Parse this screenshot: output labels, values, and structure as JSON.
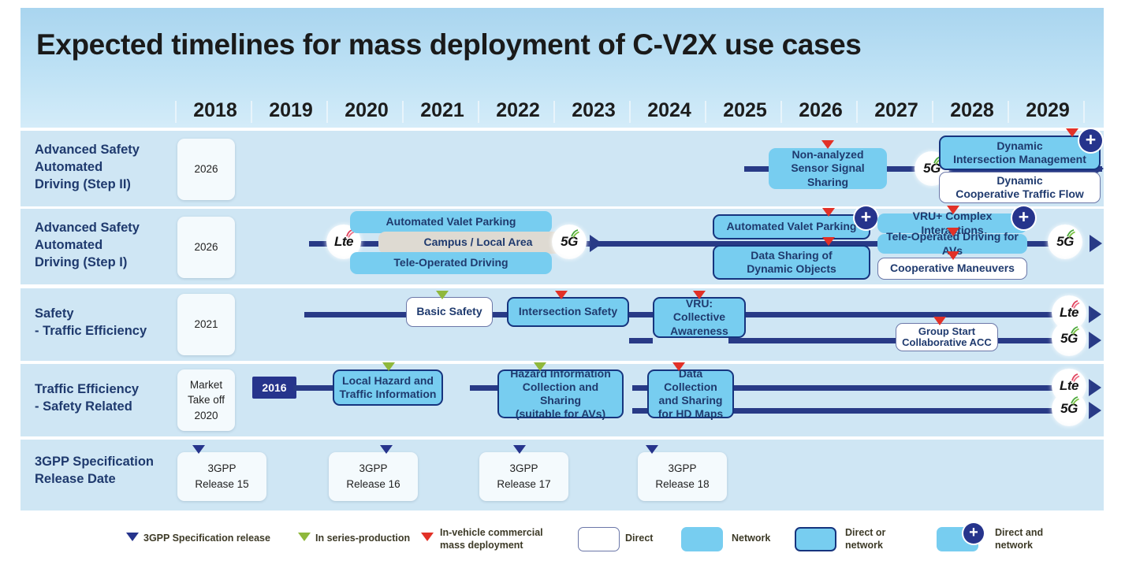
{
  "header": {
    "title": "Expected timelines for mass deployment of C-V2X use cases"
  },
  "timeline": {
    "years": [
      "2018",
      "2019",
      "2020",
      "2021",
      "2022",
      "2023",
      "2024",
      "2025",
      "2026",
      "2027",
      "2028",
      "2029"
    ]
  },
  "rows": [
    {
      "label": "Advanced Safety\nAutomated\nDriving (Step II)",
      "label_l1": "Advanced Safety",
      "label_l2": "Automated",
      "label_l3": "Driving (Step II)",
      "year_card": "2026",
      "items": [
        {
          "text": "Non-analyzed Sensor Signal Sharing",
          "l1": "Non-analyzed",
          "l2": "Sensor Signal Sharing",
          "style": "network"
        },
        {
          "text": "Dynamic Intersection Management",
          "l1": "Dynamic",
          "l2": "Intersection Management",
          "style": "dirornet"
        },
        {
          "text": "Dynamic Cooperative Traffic Flow",
          "l1": "Dynamic",
          "l2": "Cooperative Traffic Flow",
          "style": "direct"
        }
      ],
      "tech": [
        "5G"
      ]
    },
    {
      "label": "Advanced Safety\nAutomated\nDriving (Step I)",
      "label_l1": "Advanced Safety",
      "label_l2": "Automated",
      "label_l3": "Driving (Step I)",
      "year_card": "2026",
      "items": [
        {
          "text": "Automated Valet Parking",
          "style": "network"
        },
        {
          "text": "Campus / Local Area",
          "style": "grey"
        },
        {
          "text": "Tele-Operated Driving",
          "style": "network"
        },
        {
          "text": "Automated Valet Parking",
          "style": "dirornet"
        },
        {
          "text": "Data Sharing of Dynamic Objects",
          "l1": "Data Sharing of",
          "l2": "Dynamic Objects",
          "style": "dirornet"
        },
        {
          "text": "VRU+ Complex Interactions",
          "style": "network"
        },
        {
          "text": "Tele-Operated Driving for AVs",
          "style": "network"
        },
        {
          "text": "Cooperative Maneuvers",
          "style": "direct"
        }
      ],
      "tech": [
        "Lte",
        "5G",
        "5G"
      ]
    },
    {
      "label": "Safety\n- Traffic Efficiency",
      "label_l1": "Safety",
      "label_l2": "- Traffic Efficiency",
      "year_card": "2021",
      "items": [
        {
          "text": "Basic Safety",
          "style": "direct"
        },
        {
          "text": "Intersection Safety",
          "style": "dirornet"
        },
        {
          "text": "VRU: Collective Awareness",
          "l1": "VRU: Collective",
          "l2": "Awareness",
          "style": "dirornet"
        },
        {
          "text": "Group Start Collaborative ACC",
          "l1": "Group Start",
          "l2": "Collaborative ACC",
          "style": "direct"
        }
      ],
      "tech": [
        "Lte",
        "5G"
      ]
    },
    {
      "label": "Traffic Efficiency\n- Safety Related",
      "label_l1": "Traffic Efficiency",
      "label_l2": "- Safety Related",
      "year_card": "Market Take off 2020",
      "year_card_l1": "Market",
      "year_card_l2": "Take off",
      "year_card_l3": "2020",
      "marker_2016": "2016",
      "items": [
        {
          "text": "Local Hazard and Traffic Information",
          "l1": "Local Hazard and",
          "l2": "Traffic Information",
          "style": "dirornet"
        },
        {
          "text": "Hazard Information Collection and Sharing (suitable for AVs)",
          "l1": "Hazard Information",
          "l2": "Collection and Sharing",
          "l3": "(suitable for AVs)",
          "style": "dirornet"
        },
        {
          "text": "Data Collection and Sharing for HD Maps",
          "l1": "Data Collection",
          "l2": "and Sharing",
          "l3": "for HD Maps",
          "style": "dirornet"
        }
      ],
      "tech": [
        "Lte",
        "5G"
      ]
    },
    {
      "label": "3GPP Specification\nRelease Date",
      "label_l1": "3GPP Specification",
      "label_l2": "Release Date",
      "releases": [
        {
          "l1": "3GPP",
          "l2": "Release 15"
        },
        {
          "l1": "3GPP",
          "l2": "Release 16"
        },
        {
          "l1": "3GPP",
          "l2": "Release 17"
        },
        {
          "l1": "3GPP",
          "l2": "Release 18"
        }
      ]
    }
  ],
  "legend": {
    "markers": [
      {
        "label": "3GPP Specification release",
        "color": "#26348c"
      },
      {
        "label": "In series-production",
        "color": "#8fb83c"
      },
      {
        "label_l1": "In-vehicle commercial",
        "label_l2": "mass deployment",
        "color": "#e23127"
      }
    ],
    "swatches": [
      {
        "label": "Direct",
        "style": "direct"
      },
      {
        "label": "Network",
        "style": "network"
      },
      {
        "label_l1": "Direct or",
        "label_l2": "network",
        "style": "dirornet"
      },
      {
        "label_l1": "Direct and",
        "label_l2": "network",
        "style": "dirandnet"
      }
    ]
  },
  "colors": {
    "band_top": "#a9d5ef",
    "row_bg": "#cfe6f4",
    "line": "#283a86",
    "network": "#77cdf0",
    "border_dark": "#16347e",
    "text_navy": "#1f3a6e",
    "red_marker": "#e23127",
    "green_marker": "#8fb83c",
    "blue_marker": "#26348c"
  }
}
